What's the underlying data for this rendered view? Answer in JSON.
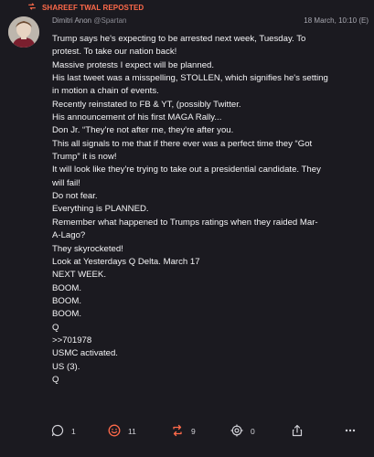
{
  "repost": {
    "label": "SHAREEF TWAL REPOSTED",
    "icon": "repost-icon"
  },
  "post": {
    "author_name": "Dimitri Anon",
    "author_handle": "@Spartan",
    "timestamp": "18 March, 10:10",
    "edited_marker": "(E)",
    "lines": [
      "Trump says he's expecting to be arrested next week, Tuesday. To",
      "protest. To take our nation back!",
      "Massive protests I expect will be planned.",
      "His last tweet was a misspelling, STOLLEN, which signifies he's setting",
      "in motion a chain of events.",
      "Recently reinstated to FB & YT, (possibly Twitter.",
      "His announcement of his first MAGA Rally...",
      "Don Jr. “They're not after me, they're after you.",
      "This all signals to me that if there ever was a perfect time they “Got",
      "Trump” it is now!",
      "It will look like they're trying to take out a presidential candidate. They",
      "will fail!",
      "Do not fear.",
      "Everything is PLANNED.",
      "Remember what happened to Trumps ratings when they raided Mar-",
      "A-Lago?",
      "They skyrocketed!",
      "Look at Yesterdays Q Delta. March 17",
      "NEXT WEEK.",
      "BOOM.",
      "BOOM.",
      "BOOM.",
      "Q",
      ">>701978",
      "USMC activated.",
      "US (3).",
      "Q"
    ]
  },
  "actions": {
    "comments": {
      "icon": "comment-icon",
      "count": "1"
    },
    "reactions": {
      "icon": "smiley-icon",
      "count": "11"
    },
    "reposts": {
      "icon": "repost-icon",
      "count": "9"
    },
    "views": {
      "icon": "target-icon",
      "count": "0"
    },
    "share": {
      "icon": "share-icon"
    },
    "more": {
      "icon": "more-icon"
    }
  },
  "colors": {
    "background": "#1b1a20",
    "accent": "#ff6a4a",
    "text": "#f4f4f6",
    "muted": "#a8a8b0"
  }
}
